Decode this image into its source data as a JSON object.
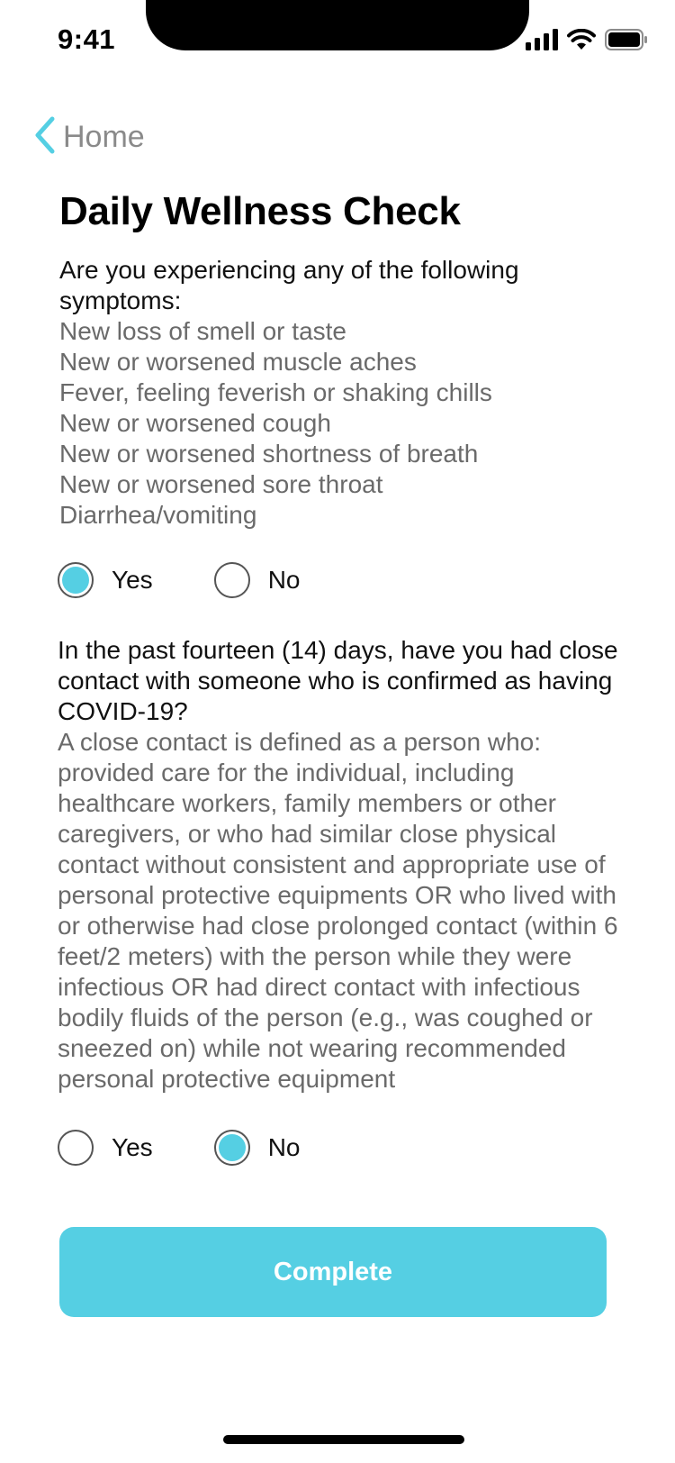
{
  "status_bar": {
    "time": "9:41",
    "icons": [
      "cellular-signal-icon",
      "wifi-icon",
      "battery-icon"
    ]
  },
  "nav": {
    "back_label": "Home",
    "back_icon": "chevron-left-icon"
  },
  "page": {
    "title": "Daily Wellness Check"
  },
  "questions": [
    {
      "text": "Are you experiencing any of the following symptoms:",
      "subtext_lines": [
        "New loss of smell or taste",
        "New or worsened muscle aches",
        "Fever, feeling feverish or shaking chills",
        "New or worsened cough",
        "New or worsened shortness of breath",
        "New or worsened sore throat",
        "Diarrhea/vomiting"
      ],
      "options": [
        "Yes",
        "No"
      ],
      "selected": "Yes"
    },
    {
      "text": "In the past fourteen (14) days, have you had close contact with someone who is confirmed as having COVID-19?",
      "subtext": "A close contact is defined as a person who: provided care for the individual, including healthcare workers, family members or other caregivers, or who had similar close physical contact without consistent and appropriate use of personal protective equipments OR who lived with or otherwise had close prolonged contact (within 6 feet/2 meters) with the person while they were infectious OR had direct contact with infectious bodily fluids of the person (e.g., was coughed or sneezed on) while not wearing recommended personal protective equipment",
      "options": [
        "Yes",
        "No"
      ],
      "selected": "No"
    }
  ],
  "actions": {
    "complete_label": "Complete"
  },
  "colors": {
    "accent": "#55cfe3",
    "secondary_text": "#6a6a6a",
    "back_label": "#8a8a8a"
  }
}
